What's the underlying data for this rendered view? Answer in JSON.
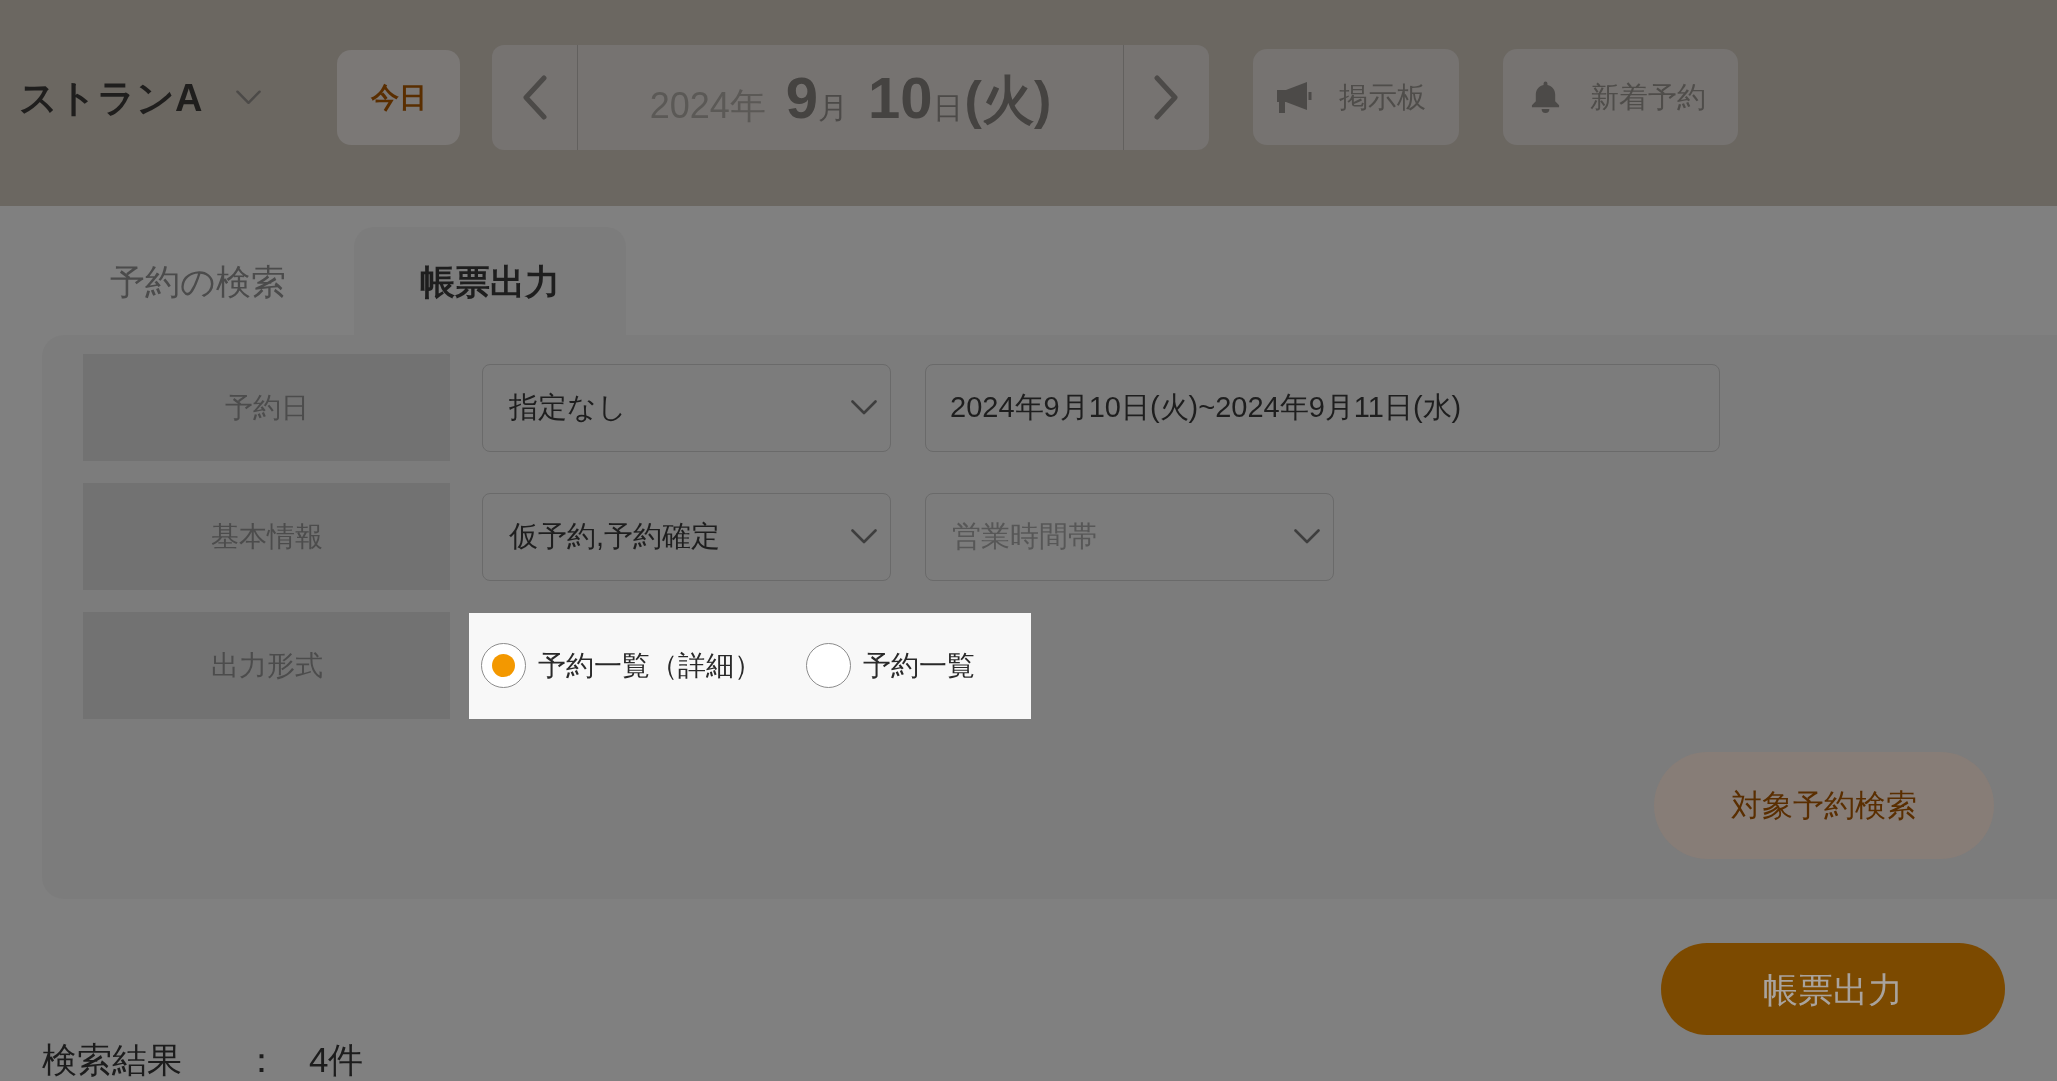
{
  "header": {
    "store_selector": {
      "name": "ストランA"
    },
    "today_button": {
      "label": "今日"
    },
    "date": [
      {
        "kind": "year",
        "text": "2024年"
      },
      {
        "kind": "number",
        "text": "9"
      },
      {
        "kind": "unit",
        "text": "月"
      },
      {
        "kind": "number",
        "text": "10"
      },
      {
        "kind": "unit",
        "text": "日"
      },
      {
        "kind": "weekday",
        "text": "(火)"
      }
    ],
    "board_button": {
      "label": "掲示板"
    },
    "new_reservations_button": {
      "label": "新着予約"
    }
  },
  "tabs": [
    {
      "label": "予約の検索",
      "selected": false
    },
    {
      "label": "帳票出力",
      "selected": true
    }
  ],
  "form": {
    "rows": [
      {
        "label": "予約日",
        "highlighted": false,
        "fields": [
          {
            "kind": "select",
            "value": "指定なし"
          },
          {
            "kind": "text",
            "value": "2024年9月10日(火)~2024年9月11日(水)"
          }
        ]
      },
      {
        "label": "基本情報",
        "highlighted": false,
        "fields": [
          {
            "kind": "select",
            "value": "仮予約,予約確定"
          },
          {
            "kind": "select",
            "placeholder": "営業時間帯"
          }
        ]
      },
      {
        "label": "出力形式",
        "highlighted": true,
        "fields": [
          {
            "kind": "radio",
            "options": [
              {
                "label": "予約一覧（詳細）",
                "selected": true
              },
              {
                "label": "予約一覧",
                "selected": false
              }
            ]
          }
        ]
      }
    ],
    "search_button": {
      "label": "対象予約検索"
    }
  },
  "export_button": {
    "label": "帳票出力"
  },
  "results": {
    "label": "検索結果",
    "separator": "：",
    "count": "4件"
  }
}
